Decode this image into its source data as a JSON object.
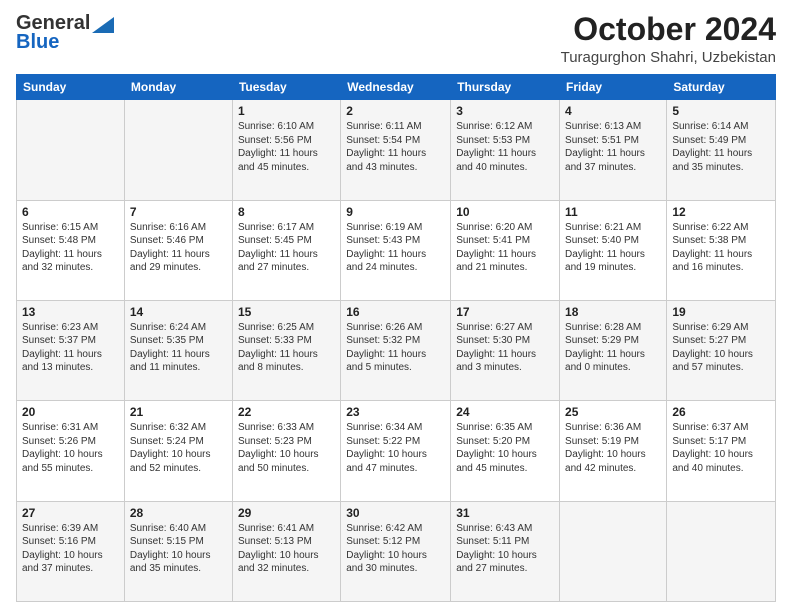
{
  "header": {
    "logo": {
      "general": "General",
      "blue": "Blue"
    },
    "title": "October 2024",
    "location": "Turagurghon Shahri, Uzbekistan"
  },
  "days_of_week": [
    "Sunday",
    "Monday",
    "Tuesday",
    "Wednesday",
    "Thursday",
    "Friday",
    "Saturday"
  ],
  "weeks": [
    [
      {
        "day": "",
        "info": ""
      },
      {
        "day": "",
        "info": ""
      },
      {
        "day": "1",
        "info": "Sunrise: 6:10 AM\nSunset: 5:56 PM\nDaylight: 11 hours and 45 minutes."
      },
      {
        "day": "2",
        "info": "Sunrise: 6:11 AM\nSunset: 5:54 PM\nDaylight: 11 hours and 43 minutes."
      },
      {
        "day": "3",
        "info": "Sunrise: 6:12 AM\nSunset: 5:53 PM\nDaylight: 11 hours and 40 minutes."
      },
      {
        "day": "4",
        "info": "Sunrise: 6:13 AM\nSunset: 5:51 PM\nDaylight: 11 hours and 37 minutes."
      },
      {
        "day": "5",
        "info": "Sunrise: 6:14 AM\nSunset: 5:49 PM\nDaylight: 11 hours and 35 minutes."
      }
    ],
    [
      {
        "day": "6",
        "info": "Sunrise: 6:15 AM\nSunset: 5:48 PM\nDaylight: 11 hours and 32 minutes."
      },
      {
        "day": "7",
        "info": "Sunrise: 6:16 AM\nSunset: 5:46 PM\nDaylight: 11 hours and 29 minutes."
      },
      {
        "day": "8",
        "info": "Sunrise: 6:17 AM\nSunset: 5:45 PM\nDaylight: 11 hours and 27 minutes."
      },
      {
        "day": "9",
        "info": "Sunrise: 6:19 AM\nSunset: 5:43 PM\nDaylight: 11 hours and 24 minutes."
      },
      {
        "day": "10",
        "info": "Sunrise: 6:20 AM\nSunset: 5:41 PM\nDaylight: 11 hours and 21 minutes."
      },
      {
        "day": "11",
        "info": "Sunrise: 6:21 AM\nSunset: 5:40 PM\nDaylight: 11 hours and 19 minutes."
      },
      {
        "day": "12",
        "info": "Sunrise: 6:22 AM\nSunset: 5:38 PM\nDaylight: 11 hours and 16 minutes."
      }
    ],
    [
      {
        "day": "13",
        "info": "Sunrise: 6:23 AM\nSunset: 5:37 PM\nDaylight: 11 hours and 13 minutes."
      },
      {
        "day": "14",
        "info": "Sunrise: 6:24 AM\nSunset: 5:35 PM\nDaylight: 11 hours and 11 minutes."
      },
      {
        "day": "15",
        "info": "Sunrise: 6:25 AM\nSunset: 5:33 PM\nDaylight: 11 hours and 8 minutes."
      },
      {
        "day": "16",
        "info": "Sunrise: 6:26 AM\nSunset: 5:32 PM\nDaylight: 11 hours and 5 minutes."
      },
      {
        "day": "17",
        "info": "Sunrise: 6:27 AM\nSunset: 5:30 PM\nDaylight: 11 hours and 3 minutes."
      },
      {
        "day": "18",
        "info": "Sunrise: 6:28 AM\nSunset: 5:29 PM\nDaylight: 11 hours and 0 minutes."
      },
      {
        "day": "19",
        "info": "Sunrise: 6:29 AM\nSunset: 5:27 PM\nDaylight: 10 hours and 57 minutes."
      }
    ],
    [
      {
        "day": "20",
        "info": "Sunrise: 6:31 AM\nSunset: 5:26 PM\nDaylight: 10 hours and 55 minutes."
      },
      {
        "day": "21",
        "info": "Sunrise: 6:32 AM\nSunset: 5:24 PM\nDaylight: 10 hours and 52 minutes."
      },
      {
        "day": "22",
        "info": "Sunrise: 6:33 AM\nSunset: 5:23 PM\nDaylight: 10 hours and 50 minutes."
      },
      {
        "day": "23",
        "info": "Sunrise: 6:34 AM\nSunset: 5:22 PM\nDaylight: 10 hours and 47 minutes."
      },
      {
        "day": "24",
        "info": "Sunrise: 6:35 AM\nSunset: 5:20 PM\nDaylight: 10 hours and 45 minutes."
      },
      {
        "day": "25",
        "info": "Sunrise: 6:36 AM\nSunset: 5:19 PM\nDaylight: 10 hours and 42 minutes."
      },
      {
        "day": "26",
        "info": "Sunrise: 6:37 AM\nSunset: 5:17 PM\nDaylight: 10 hours and 40 minutes."
      }
    ],
    [
      {
        "day": "27",
        "info": "Sunrise: 6:39 AM\nSunset: 5:16 PM\nDaylight: 10 hours and 37 minutes."
      },
      {
        "day": "28",
        "info": "Sunrise: 6:40 AM\nSunset: 5:15 PM\nDaylight: 10 hours and 35 minutes."
      },
      {
        "day": "29",
        "info": "Sunrise: 6:41 AM\nSunset: 5:13 PM\nDaylight: 10 hours and 32 minutes."
      },
      {
        "day": "30",
        "info": "Sunrise: 6:42 AM\nSunset: 5:12 PM\nDaylight: 10 hours and 30 minutes."
      },
      {
        "day": "31",
        "info": "Sunrise: 6:43 AM\nSunset: 5:11 PM\nDaylight: 10 hours and 27 minutes."
      },
      {
        "day": "",
        "info": ""
      },
      {
        "day": "",
        "info": ""
      }
    ]
  ]
}
